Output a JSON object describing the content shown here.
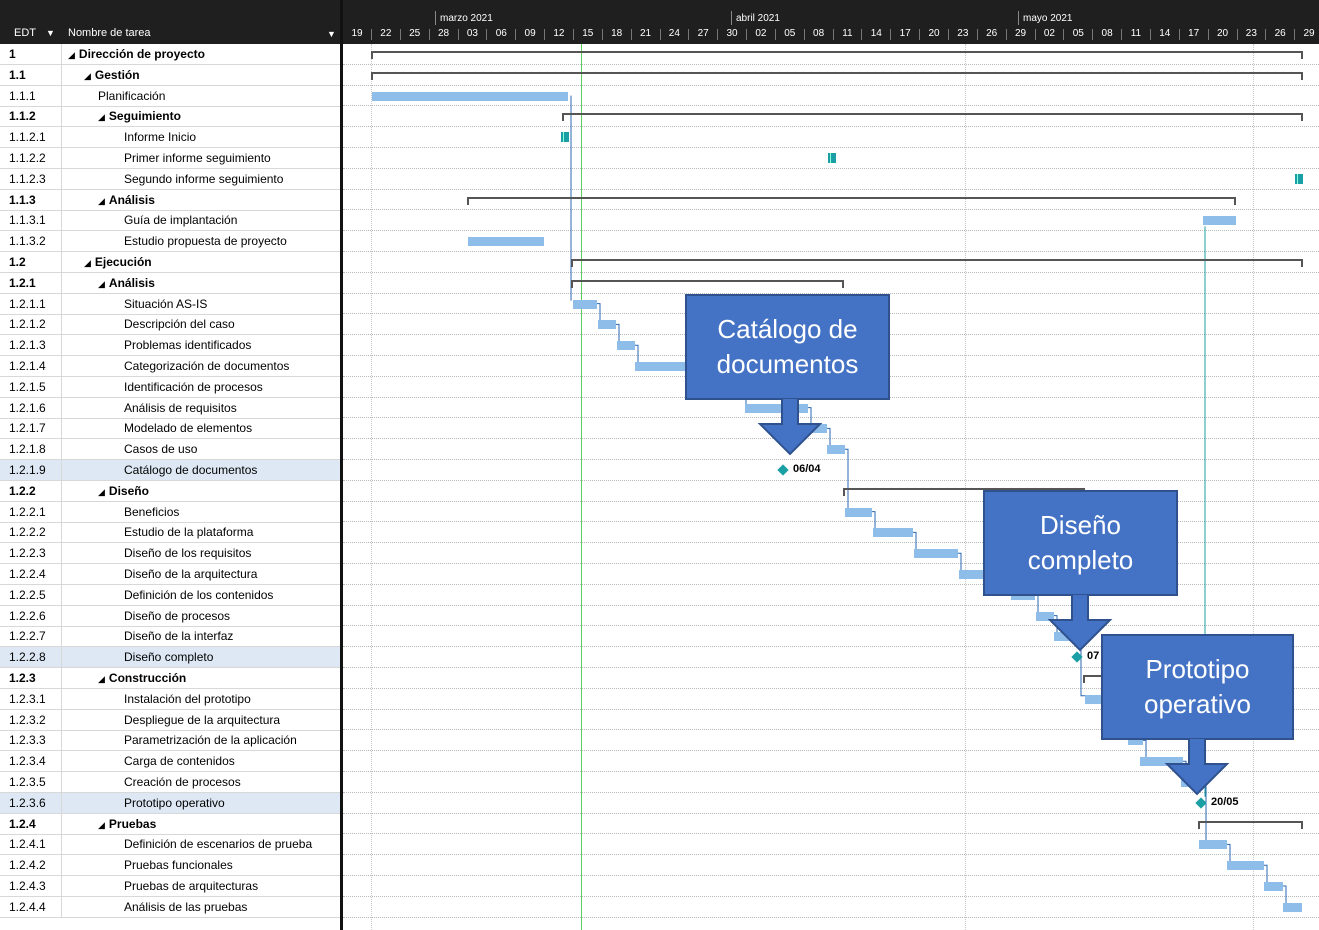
{
  "header": {
    "edt_label": "EDT",
    "name_label": "Nombre de tarea",
    "months": [
      "marzo 2021",
      "abril 2021",
      "mayo 2021"
    ],
    "days": [
      "19",
      "22",
      "25",
      "28",
      "03",
      "06",
      "09",
      "12",
      "15",
      "18",
      "21",
      "24",
      "27",
      "30",
      "02",
      "05",
      "08",
      "11",
      "14",
      "17",
      "20",
      "23",
      "26",
      "29",
      "02",
      "05",
      "08",
      "11",
      "14",
      "17",
      "20",
      "23",
      "26",
      "29"
    ]
  },
  "tasks": [
    {
      "edt": "1",
      "name": "Dirección de proyecto",
      "level": 0,
      "summary": true
    },
    {
      "edt": "1.1",
      "name": "Gestión",
      "level": 1,
      "summary": true
    },
    {
      "edt": "1.1.1",
      "name": "Planificación",
      "level": 2,
      "summary": false
    },
    {
      "edt": "1.1.2",
      "name": "Seguimiento",
      "level": 2,
      "summary": true
    },
    {
      "edt": "1.1.2.1",
      "name": "Informe Inicio",
      "level": 3,
      "summary": false
    },
    {
      "edt": "1.1.2.2",
      "name": "Primer informe seguimiento",
      "level": 3,
      "summary": false
    },
    {
      "edt": "1.1.2.3",
      "name": "Segundo informe seguimiento",
      "level": 3,
      "summary": false
    },
    {
      "edt": "1.1.3",
      "name": "Análisis",
      "level": 2,
      "summary": true
    },
    {
      "edt": "1.1.3.1",
      "name": "Guía de implantación",
      "level": 3,
      "summary": false
    },
    {
      "edt": "1.1.3.2",
      "name": "Estudio propuesta de proyecto",
      "level": 3,
      "summary": false
    },
    {
      "edt": "1.2",
      "name": "Ejecución",
      "level": 1,
      "summary": true
    },
    {
      "edt": "1.2.1",
      "name": "Análisis",
      "level": 2,
      "summary": true
    },
    {
      "edt": "1.2.1.1",
      "name": "Situación AS-IS",
      "level": 3,
      "summary": false
    },
    {
      "edt": "1.2.1.2",
      "name": "Descripción del caso",
      "level": 3,
      "summary": false
    },
    {
      "edt": "1.2.1.3",
      "name": "Problemas identificados",
      "level": 3,
      "summary": false
    },
    {
      "edt": "1.2.1.4",
      "name": "Categorización de documentos",
      "level": 3,
      "summary": false
    },
    {
      "edt": "1.2.1.5",
      "name": "Identificación de procesos",
      "level": 3,
      "summary": false
    },
    {
      "edt": "1.2.1.6",
      "name": "Análisis de requisitos",
      "level": 3,
      "summary": false
    },
    {
      "edt": "1.2.1.7",
      "name": "Modelado de elementos",
      "level": 3,
      "summary": false
    },
    {
      "edt": "1.2.1.8",
      "name": "Casos de uso",
      "level": 3,
      "summary": false
    },
    {
      "edt": "1.2.1.9",
      "name": "Catálogo de documentos",
      "level": 3,
      "summary": false,
      "selected": true
    },
    {
      "edt": "1.2.2",
      "name": "Diseño",
      "level": 2,
      "summary": true
    },
    {
      "edt": "1.2.2.1",
      "name": "Beneficios",
      "level": 3,
      "summary": false
    },
    {
      "edt": "1.2.2.2",
      "name": "Estudio de la plataforma",
      "level": 3,
      "summary": false
    },
    {
      "edt": "1.2.2.3",
      "name": "Diseño de los requisitos",
      "level": 3,
      "summary": false
    },
    {
      "edt": "1.2.2.4",
      "name": "Diseño de la arquitectura",
      "level": 3,
      "summary": false
    },
    {
      "edt": "1.2.2.5",
      "name": "Definición de los contenidos",
      "level": 3,
      "summary": false
    },
    {
      "edt": "1.2.2.6",
      "name": "Diseño de procesos",
      "level": 3,
      "summary": false
    },
    {
      "edt": "1.2.2.7",
      "name": "Diseño de la interfaz",
      "level": 3,
      "summary": false
    },
    {
      "edt": "1.2.2.8",
      "name": "Diseño completo",
      "level": 3,
      "summary": false,
      "selected": true
    },
    {
      "edt": "1.2.3",
      "name": "Construcción",
      "level": 2,
      "summary": true
    },
    {
      "edt": "1.2.3.1",
      "name": "Instalación del prototipo",
      "level": 3,
      "summary": false
    },
    {
      "edt": "1.2.3.2",
      "name": "Despliegue de la arquitectura",
      "level": 3,
      "summary": false
    },
    {
      "edt": "1.2.3.3",
      "name": "Parametrización de la aplicación",
      "level": 3,
      "summary": false
    },
    {
      "edt": "1.2.3.4",
      "name": "Carga de contenidos",
      "level": 3,
      "summary": false
    },
    {
      "edt": "1.2.3.5",
      "name": "Creación de procesos",
      "level": 3,
      "summary": false
    },
    {
      "edt": "1.2.3.6",
      "name": "Prototipo operativo",
      "level": 3,
      "summary": false,
      "selected": true
    },
    {
      "edt": "1.2.4",
      "name": "Pruebas",
      "level": 2,
      "summary": true
    },
    {
      "edt": "1.2.4.1",
      "name": "Definición de escenarios de prueba",
      "level": 3,
      "summary": false
    },
    {
      "edt": "1.2.4.2",
      "name": "Pruebas funcionales",
      "level": 3,
      "summary": false
    },
    {
      "edt": "1.2.4.3",
      "name": "Pruebas de arquitecturas",
      "level": 3,
      "summary": false
    },
    {
      "edt": "1.2.4.4",
      "name": "Análisis de las pruebas",
      "level": 3,
      "summary": false
    }
  ],
  "milestones": [
    {
      "task": "1.2.1.9",
      "label": "06/04"
    },
    {
      "task": "1.2.2.8",
      "label": "07"
    },
    {
      "task": "1.2.3.6",
      "label": "20/05"
    }
  ],
  "callouts": [
    {
      "text": "Catálogo de documentos"
    },
    {
      "text": "Diseño completo"
    },
    {
      "text": "Prototipo operativo"
    }
  ],
  "colors": {
    "task_bar": "#8ebde9",
    "milestone": "#1aa0a4",
    "callout": "#4472c4",
    "header": "#1f1f1f",
    "today_line": "#5fcf5f"
  }
}
